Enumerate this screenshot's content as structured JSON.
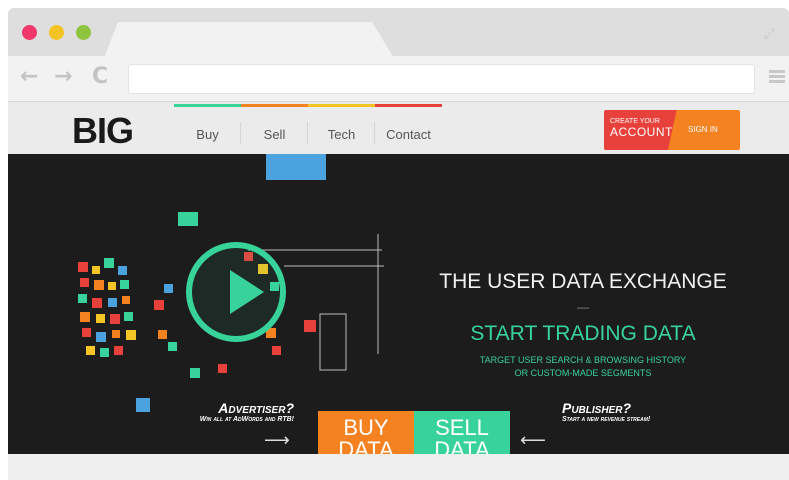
{
  "browser": {
    "tab_title": "",
    "address": "",
    "back_icon": "←",
    "forward_icon": "→",
    "reload_icon": "C",
    "expand_icon": "⤢"
  },
  "header": {
    "logo": "BIG",
    "nav": [
      {
        "label": "Buy",
        "accent": "#38d39b"
      },
      {
        "label": "Sell",
        "accent": "#f58220"
      },
      {
        "label": "Tech",
        "accent": "#f4c324"
      },
      {
        "label": "Contact",
        "accent": "#e8403a"
      }
    ],
    "cta_create_small": "CREATE YOUR",
    "cta_create_big": "ACCOUNT",
    "cta_signin": "SIGN IN"
  },
  "hero": {
    "title": "THE USER DATA EXCHANGE",
    "dash": "—",
    "subtitle": "START TRADING DATA",
    "desc_line1": "TARGET USER SEARCH & BROWSING HISTORY",
    "desc_line2": "OR CUSTOM-MADE SEGMENTS"
  },
  "actions": {
    "advertiser_title": "Advertiser?",
    "advertiser_sub": "Win all at AdWords and RTB!",
    "publisher_title": "Publisher?",
    "publisher_sub": "Start a new revenue stream!",
    "buy_line1": "BUY",
    "buy_line2": "DATA",
    "sell_line1": "SELL",
    "sell_line2": "DATA",
    "chevron": "⌄"
  },
  "colors": {
    "green": "#38d39b",
    "orange": "#f58220",
    "red": "#e8403a",
    "yellow": "#f4c324"
  }
}
